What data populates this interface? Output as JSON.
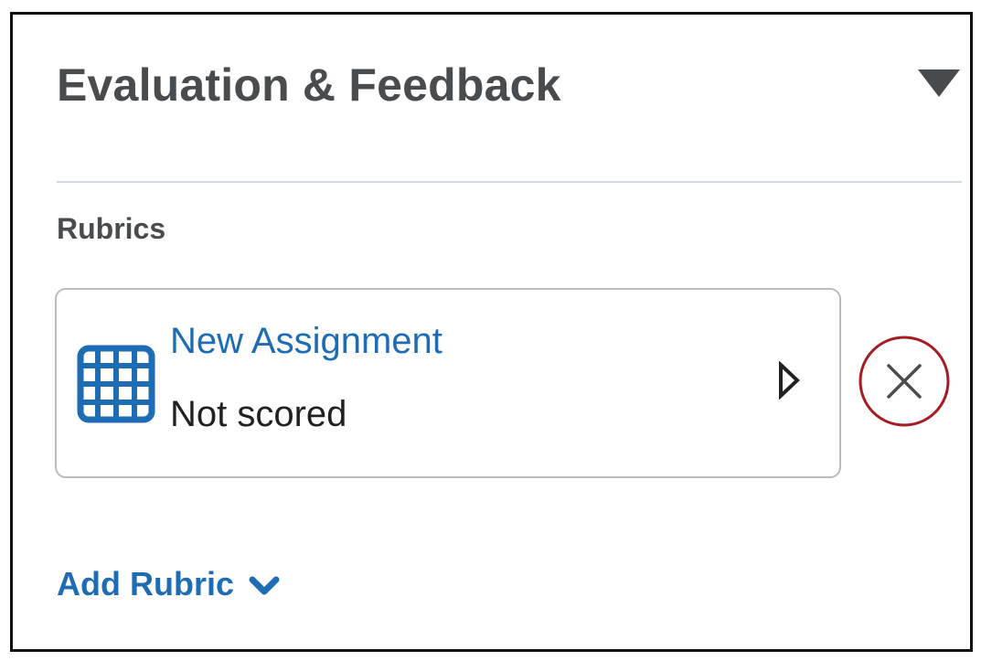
{
  "panel": {
    "title": "Evaluation & Feedback",
    "collapse_icon": "caret-down-icon"
  },
  "rubrics": {
    "section_label": "Rubrics",
    "items": [
      {
        "name": "New Assignment",
        "status": "Not scored",
        "icon": "rubric-grid-icon",
        "expand_icon": "triangle-right-outline-icon",
        "remove_icon": "close-icon"
      }
    ],
    "add_label": "Add Rubric",
    "add_icon": "chevron-down-icon"
  },
  "colors": {
    "link": "#1e6db4",
    "heading": "#494c4e",
    "text": "#202122",
    "card_border": "#b9bcbf",
    "divider": "#d3d9e3",
    "highlight_ring": "#a61c24"
  }
}
